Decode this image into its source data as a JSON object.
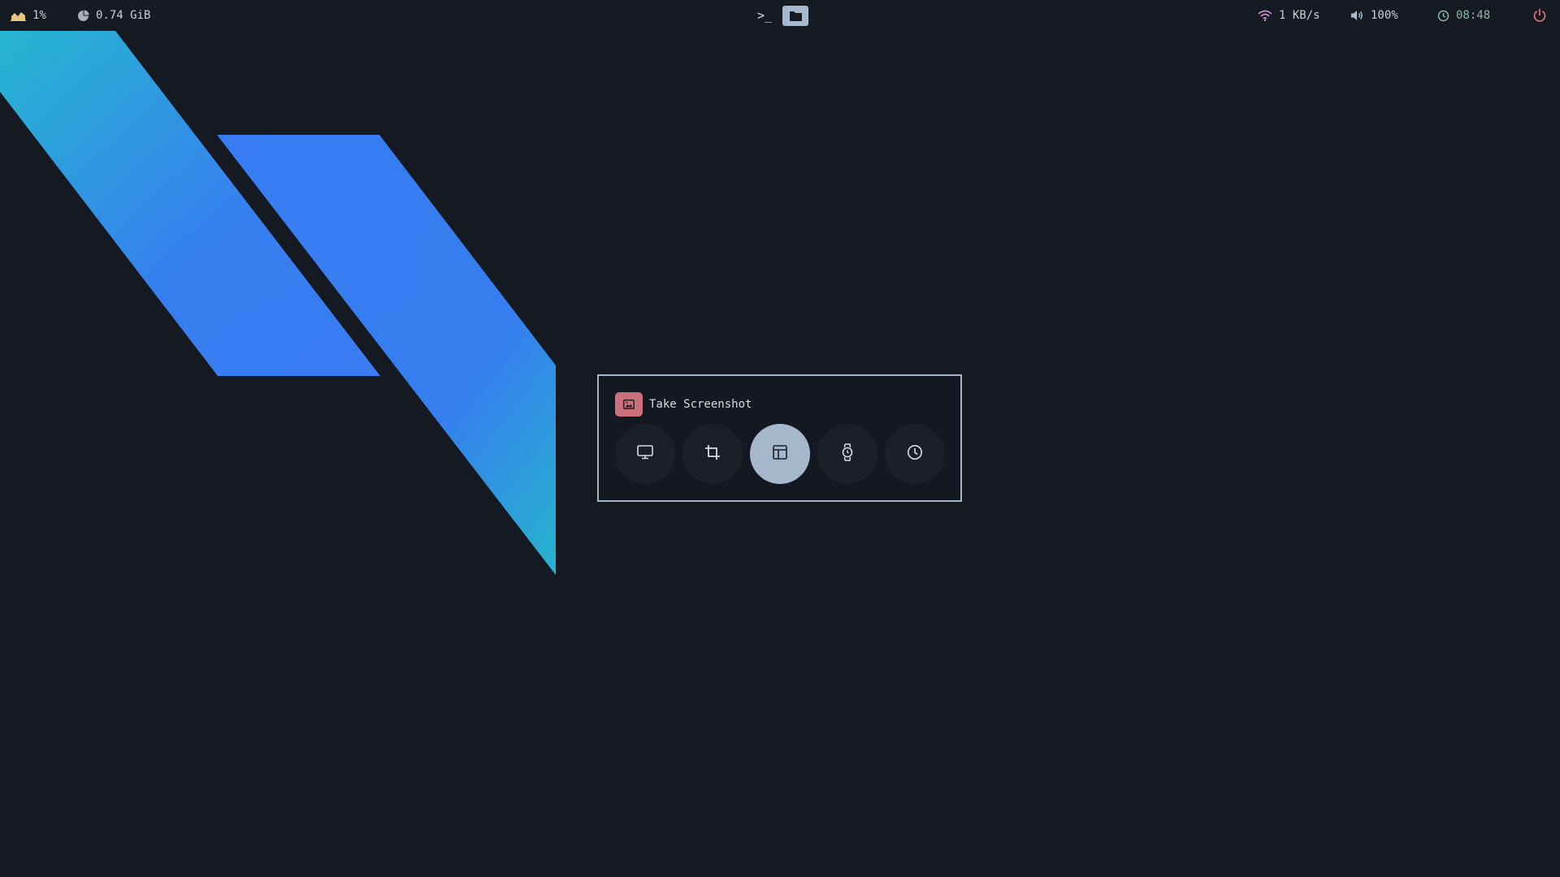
{
  "topbar": {
    "cpu": {
      "icon": "chart-area-icon",
      "value": "1%"
    },
    "memory": {
      "icon": "pie-chart-icon",
      "value": "0.74 GiB"
    },
    "workspaces": [
      {
        "icon": "terminal-icon",
        "label": ">_",
        "active": false
      },
      {
        "icon": "folder-icon",
        "active": true
      }
    ],
    "network": {
      "icon": "wifi-icon",
      "value": "1 KB/s"
    },
    "volume": {
      "icon": "volume-icon",
      "value": "100%"
    },
    "clock": {
      "icon": "clock-icon",
      "value": "08:48"
    },
    "power": {
      "icon": "power-icon"
    }
  },
  "screenshot_dialog": {
    "title": "Take Screenshot",
    "title_icon": "image-icon",
    "modes": [
      {
        "icon": "monitor-icon",
        "active": false
      },
      {
        "icon": "crop-icon",
        "active": false
      },
      {
        "icon": "window-icon",
        "active": true
      },
      {
        "icon": "watch-icon",
        "active": false
      },
      {
        "icon": "clock-icon",
        "active": false
      }
    ]
  },
  "colors": {
    "background": "#151921",
    "accent": "#a5b7cc",
    "danger": "#c9707a",
    "wallpaper_cyan": "#27b3cf",
    "wallpaper_blue": "#367cf0",
    "clock_text": "#8fb7a8"
  }
}
